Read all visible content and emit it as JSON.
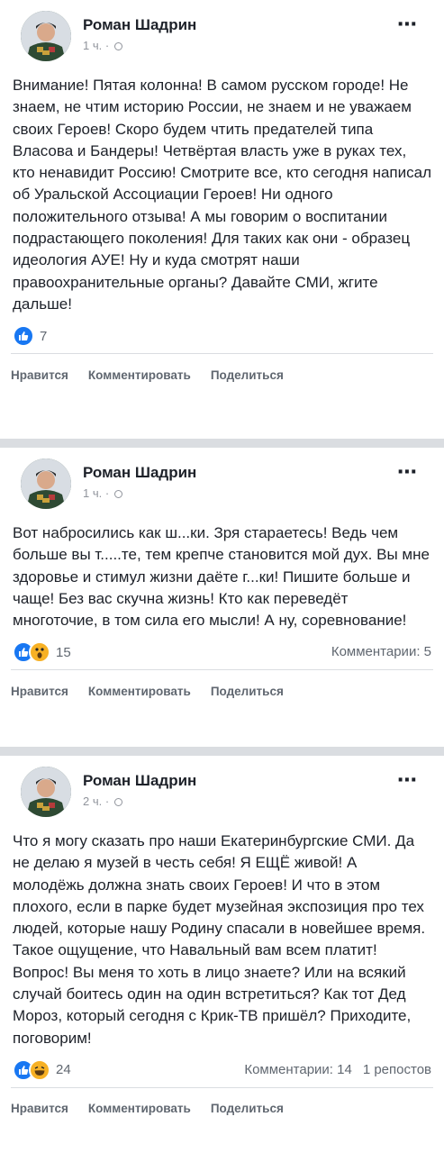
{
  "posts": [
    {
      "author": "Роман Шадрин",
      "time": "1 ч.",
      "text": "Внимание! Пятая колонна! В самом русском городе! Не знаем, не чтим историю России, не знаем и не уважаем своих Героев! Скоро будем чтить предателей типа Власова и Бандеры! Четвёртая власть уже в руках тех, кто ненавидит Россию! Смотрите все, кто сегодня написал об Уральской Ассоциации Героев! Ни одного положительного отзыва! А мы говорим о воспитании подрастающего поколения! Для таких как они - образец идеология АУЕ! Ну и куда смотрят наши правоохранительные органы? Давайте СМИ, жгите дальше!",
      "reactions": [
        "like-icon"
      ],
      "reaction_count": "7",
      "comments": "",
      "shares": ""
    },
    {
      "author": "Роман Шадрин",
      "time": "1 ч.",
      "text": "Вот набросились как ш...ки. Зря стараетесь! Ведь чем больше вы т.....те, тем крепче становится мой дух. Вы мне здоровье и стимул жизни даёте г...ки! Пишите больше и чаще! Без вас скучна жизнь! Кто как переведёт многоточие, в том сила его мысли! А ну, соревнование!",
      "reactions": [
        "like-icon",
        "wow-icon"
      ],
      "reaction_count": "15",
      "comments": "Комментарии: 5",
      "shares": ""
    },
    {
      "author": "Роман Шадрин",
      "time": "2 ч.",
      "text": "Что я могу сказать про наши Екатеринбургские СМИ. Да не делаю я музей в честь себя! Я ЕЩЁ живой! А молодёжь должна знать своих Героев! И что в этом плохого, если в парке будет музейная экспозиция про тех людей, которые нашу Родину спасали в новейшее время. Такое ощущение, что Навальный вам всем платит! Вопрос! Вы меня то хоть в лицо знаете? Или на всякий случай боитесь один на один встретиться? Как тот Дед Мороз, который сегодня с Крик-ТВ пришёл? Приходите, поговорим!",
      "reactions": [
        "like-icon",
        "haha-icon"
      ],
      "reaction_count": "24",
      "comments": "Комментарии: 14",
      "shares": "1 репостов"
    }
  ],
  "actions": {
    "like": "Нравится",
    "comment": "Комментировать",
    "share": "Поделиться"
  },
  "more_icon": "⋯",
  "colors": {
    "like_blue": "#1877f2",
    "emoji_yellow": "#f7b125",
    "separator": "#dadde1",
    "secondary_text": "#606770"
  }
}
